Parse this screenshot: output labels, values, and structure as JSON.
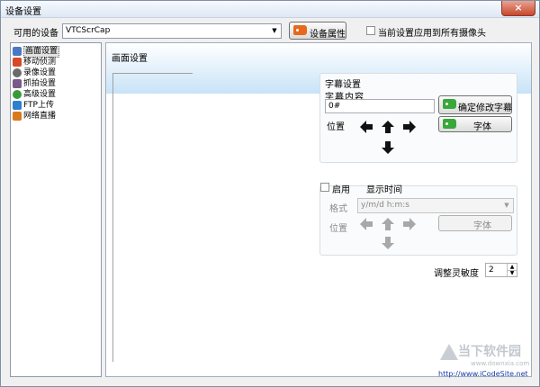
{
  "window": {
    "title": "设备设置",
    "close_icon": "×"
  },
  "device_row": {
    "available_label": "可用的设备",
    "device_value": "VTCScrCap",
    "properties_button": "设备属性",
    "apply_all_label": "当前设置应用到所有摄像头"
  },
  "tree": {
    "items": [
      {
        "label": "画面设置",
        "icon": "screen-icon",
        "color": "#4a79c4"
      },
      {
        "label": "移动侦测",
        "icon": "motion-icon",
        "color": "#d64a2a"
      },
      {
        "label": "录像设置",
        "icon": "record-icon",
        "color": "#6b6b6b"
      },
      {
        "label": "抓拍设置",
        "icon": "camera-icon",
        "color": "#7a5a8a"
      },
      {
        "label": "高级设置",
        "icon": "gear-icon",
        "color": "#3a9a3a"
      },
      {
        "label": "FTP上传",
        "icon": "ftp-icon",
        "color": "#2f7fd0"
      },
      {
        "label": "网络直播",
        "icon": "broadcast-icon",
        "color": "#d87a1a"
      }
    ]
  },
  "main": {
    "title": "画面设置",
    "caption_group": {
      "title": "字幕设置",
      "content_label": "字幕内容",
      "content_value": "0#",
      "confirm_button": "确定修改字幕",
      "position_label": "位置",
      "font_button": "字体"
    },
    "time_group": {
      "enable_label": "启用",
      "title": "显示时间",
      "format_label": "格式",
      "format_value": "y/m/d h:m:s",
      "position_label": "位置",
      "font_button": "字体"
    },
    "sensitivity": {
      "label": "调整灵敏度",
      "value": "2"
    }
  },
  "watermark": {
    "brand": "当下软件园",
    "url1": "www.downxia.com",
    "url2": "http://www.iCodeSite.net"
  },
  "colors": {
    "accent_orange": "#e8681c",
    "accent_green": "#39a83a",
    "link_blue": "#1a3aa8"
  }
}
